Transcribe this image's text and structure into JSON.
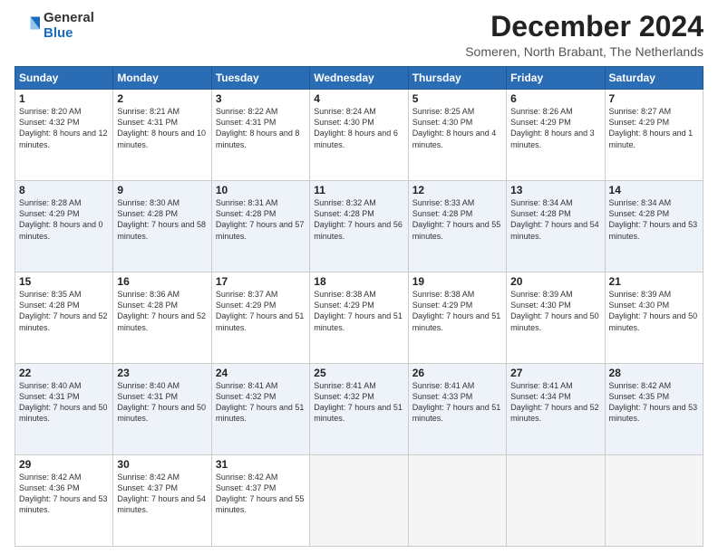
{
  "logo": {
    "general": "General",
    "blue": "Blue"
  },
  "title": {
    "month": "December 2024",
    "location": "Someren, North Brabant, The Netherlands"
  },
  "headers": [
    "Sunday",
    "Monday",
    "Tuesday",
    "Wednesday",
    "Thursday",
    "Friday",
    "Saturday"
  ],
  "weeks": [
    [
      {
        "day": "1",
        "rise": "8:20 AM",
        "set": "4:32 PM",
        "daylight": "8 hours and 12 minutes"
      },
      {
        "day": "2",
        "rise": "8:21 AM",
        "set": "4:31 PM",
        "daylight": "8 hours and 10 minutes"
      },
      {
        "day": "3",
        "rise": "8:22 AM",
        "set": "4:31 PM",
        "daylight": "8 hours and 8 minutes"
      },
      {
        "day": "4",
        "rise": "8:24 AM",
        "set": "4:30 PM",
        "daylight": "8 hours and 6 minutes"
      },
      {
        "day": "5",
        "rise": "8:25 AM",
        "set": "4:30 PM",
        "daylight": "8 hours and 4 minutes"
      },
      {
        "day": "6",
        "rise": "8:26 AM",
        "set": "4:29 PM",
        "daylight": "8 hours and 3 minutes"
      },
      {
        "day": "7",
        "rise": "8:27 AM",
        "set": "4:29 PM",
        "daylight": "8 hours and 1 minute"
      }
    ],
    [
      {
        "day": "8",
        "rise": "8:28 AM",
        "set": "4:29 PM",
        "daylight": "8 hours and 0 minutes"
      },
      {
        "day": "9",
        "rise": "8:30 AM",
        "set": "4:28 PM",
        "daylight": "7 hours and 58 minutes"
      },
      {
        "day": "10",
        "rise": "8:31 AM",
        "set": "4:28 PM",
        "daylight": "7 hours and 57 minutes"
      },
      {
        "day": "11",
        "rise": "8:32 AM",
        "set": "4:28 PM",
        "daylight": "7 hours and 56 minutes"
      },
      {
        "day": "12",
        "rise": "8:33 AM",
        "set": "4:28 PM",
        "daylight": "7 hours and 55 minutes"
      },
      {
        "day": "13",
        "rise": "8:34 AM",
        "set": "4:28 PM",
        "daylight": "7 hours and 54 minutes"
      },
      {
        "day": "14",
        "rise": "8:34 AM",
        "set": "4:28 PM",
        "daylight": "7 hours and 53 minutes"
      }
    ],
    [
      {
        "day": "15",
        "rise": "8:35 AM",
        "set": "4:28 PM",
        "daylight": "7 hours and 52 minutes"
      },
      {
        "day": "16",
        "rise": "8:36 AM",
        "set": "4:28 PM",
        "daylight": "7 hours and 52 minutes"
      },
      {
        "day": "17",
        "rise": "8:37 AM",
        "set": "4:29 PM",
        "daylight": "7 hours and 51 minutes"
      },
      {
        "day": "18",
        "rise": "8:38 AM",
        "set": "4:29 PM",
        "daylight": "7 hours and 51 minutes"
      },
      {
        "day": "19",
        "rise": "8:38 AM",
        "set": "4:29 PM",
        "daylight": "7 hours and 51 minutes"
      },
      {
        "day": "20",
        "rise": "8:39 AM",
        "set": "4:30 PM",
        "daylight": "7 hours and 50 minutes"
      },
      {
        "day": "21",
        "rise": "8:39 AM",
        "set": "4:30 PM",
        "daylight": "7 hours and 50 minutes"
      }
    ],
    [
      {
        "day": "22",
        "rise": "8:40 AM",
        "set": "4:31 PM",
        "daylight": "7 hours and 50 minutes"
      },
      {
        "day": "23",
        "rise": "8:40 AM",
        "set": "4:31 PM",
        "daylight": "7 hours and 50 minutes"
      },
      {
        "day": "24",
        "rise": "8:41 AM",
        "set": "4:32 PM",
        "daylight": "7 hours and 51 minutes"
      },
      {
        "day": "25",
        "rise": "8:41 AM",
        "set": "4:32 PM",
        "daylight": "7 hours and 51 minutes"
      },
      {
        "day": "26",
        "rise": "8:41 AM",
        "set": "4:33 PM",
        "daylight": "7 hours and 51 minutes"
      },
      {
        "day": "27",
        "rise": "8:41 AM",
        "set": "4:34 PM",
        "daylight": "7 hours and 52 minutes"
      },
      {
        "day": "28",
        "rise": "8:42 AM",
        "set": "4:35 PM",
        "daylight": "7 hours and 53 minutes"
      }
    ],
    [
      {
        "day": "29",
        "rise": "8:42 AM",
        "set": "4:36 PM",
        "daylight": "7 hours and 53 minutes"
      },
      {
        "day": "30",
        "rise": "8:42 AM",
        "set": "4:37 PM",
        "daylight": "7 hours and 54 minutes"
      },
      {
        "day": "31",
        "rise": "8:42 AM",
        "set": "4:37 PM",
        "daylight": "7 hours and 55 minutes"
      },
      null,
      null,
      null,
      null
    ]
  ]
}
